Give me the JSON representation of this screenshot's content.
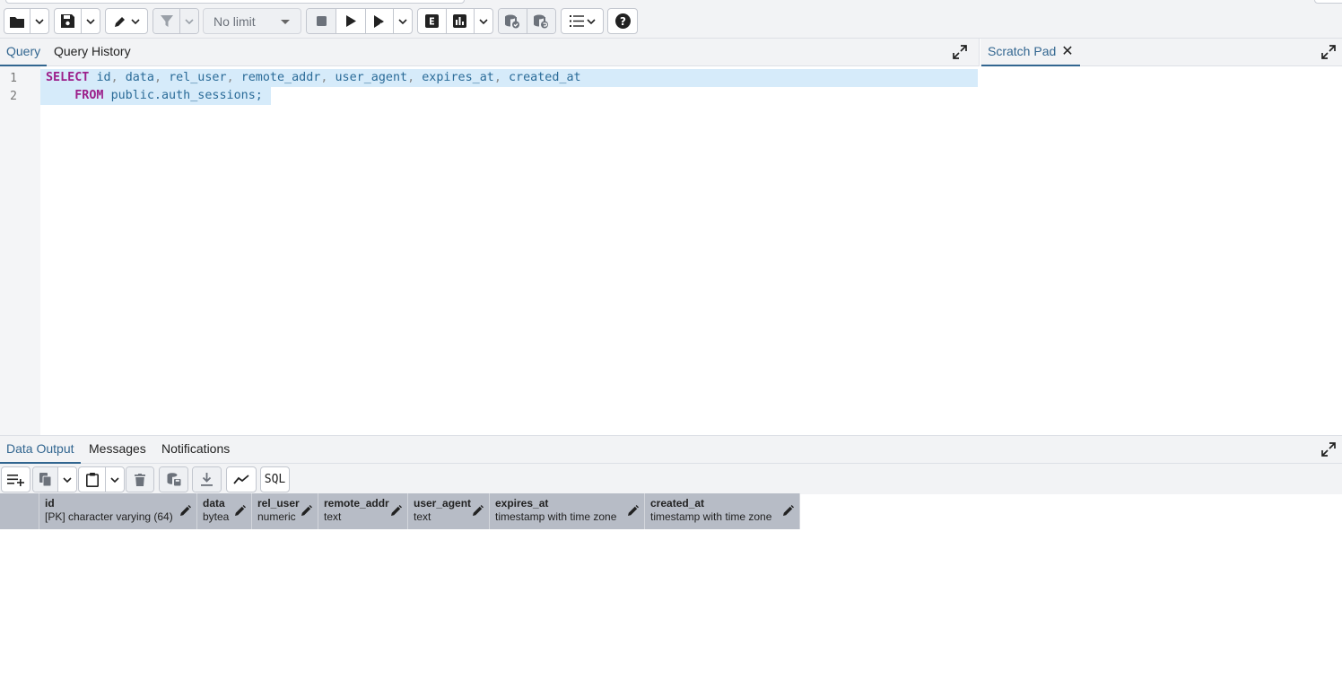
{
  "toolbar": {
    "row_limit": "No limit",
    "sql_button": "SQL"
  },
  "query_tabs": [
    {
      "label": "Query",
      "active": true
    },
    {
      "label": "Query History",
      "active": false
    }
  ],
  "scratch_pad": {
    "label": "Scratch Pad",
    "close": "✕"
  },
  "editor": {
    "line_numbers": [
      "1",
      "2"
    ],
    "line1": {
      "kw": "SELECT",
      "cols": [
        "id",
        "data",
        "rel_user",
        "remote_addr",
        "user_agent",
        "expires_at",
        "created_at"
      ]
    },
    "line2": {
      "kw": "FROM",
      "table": "public.auth_sessions;"
    }
  },
  "output_tabs": [
    {
      "label": "Data Output",
      "active": true
    },
    {
      "label": "Messages",
      "active": false
    },
    {
      "label": "Notifications",
      "active": false
    }
  ],
  "columns": [
    {
      "name": "id",
      "type": "[PK] character varying (64)"
    },
    {
      "name": "data",
      "type": "bytea"
    },
    {
      "name": "rel_user",
      "type": "numeric"
    },
    {
      "name": "remote_addr",
      "type": "text"
    },
    {
      "name": "user_agent",
      "type": "text"
    },
    {
      "name": "expires_at",
      "type": "timestamp with time zone"
    },
    {
      "name": "created_at",
      "type": "timestamp with time zone"
    }
  ],
  "colors": {
    "accent": "#326690",
    "keyword": "#9c1f8a",
    "identifier": "#2a6b98",
    "selection": "#d6ebfa",
    "grid_header": "#b7bcc6"
  }
}
